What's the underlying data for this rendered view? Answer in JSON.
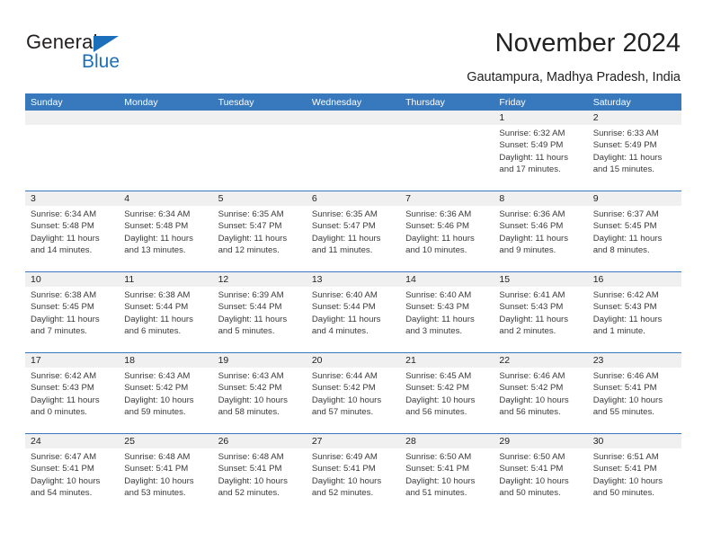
{
  "brand": {
    "name_part1": "General",
    "name_part2": "Blue",
    "accent_color": "#1c6fba"
  },
  "header": {
    "title": "November 2024",
    "location": "Gautampura, Madhya Pradesh, India"
  },
  "calendar": {
    "header_color": "#3878bd",
    "weekdays": [
      "Sunday",
      "Monday",
      "Tuesday",
      "Wednesday",
      "Thursday",
      "Friday",
      "Saturday"
    ],
    "weeks": [
      [
        {
          "day": "",
          "lines": []
        },
        {
          "day": "",
          "lines": []
        },
        {
          "day": "",
          "lines": []
        },
        {
          "day": "",
          "lines": []
        },
        {
          "day": "",
          "lines": []
        },
        {
          "day": "1",
          "lines": [
            "Sunrise: 6:32 AM",
            "Sunset: 5:49 PM",
            "Daylight: 11 hours",
            "and 17 minutes."
          ]
        },
        {
          "day": "2",
          "lines": [
            "Sunrise: 6:33 AM",
            "Sunset: 5:49 PM",
            "Daylight: 11 hours",
            "and 15 minutes."
          ]
        }
      ],
      [
        {
          "day": "3",
          "lines": [
            "Sunrise: 6:34 AM",
            "Sunset: 5:48 PM",
            "Daylight: 11 hours",
            "and 14 minutes."
          ]
        },
        {
          "day": "4",
          "lines": [
            "Sunrise: 6:34 AM",
            "Sunset: 5:48 PM",
            "Daylight: 11 hours",
            "and 13 minutes."
          ]
        },
        {
          "day": "5",
          "lines": [
            "Sunrise: 6:35 AM",
            "Sunset: 5:47 PM",
            "Daylight: 11 hours",
            "and 12 minutes."
          ]
        },
        {
          "day": "6",
          "lines": [
            "Sunrise: 6:35 AM",
            "Sunset: 5:47 PM",
            "Daylight: 11 hours",
            "and 11 minutes."
          ]
        },
        {
          "day": "7",
          "lines": [
            "Sunrise: 6:36 AM",
            "Sunset: 5:46 PM",
            "Daylight: 11 hours",
            "and 10 minutes."
          ]
        },
        {
          "day": "8",
          "lines": [
            "Sunrise: 6:36 AM",
            "Sunset: 5:46 PM",
            "Daylight: 11 hours",
            "and 9 minutes."
          ]
        },
        {
          "day": "9",
          "lines": [
            "Sunrise: 6:37 AM",
            "Sunset: 5:45 PM",
            "Daylight: 11 hours",
            "and 8 minutes."
          ]
        }
      ],
      [
        {
          "day": "10",
          "lines": [
            "Sunrise: 6:38 AM",
            "Sunset: 5:45 PM",
            "Daylight: 11 hours",
            "and 7 minutes."
          ]
        },
        {
          "day": "11",
          "lines": [
            "Sunrise: 6:38 AM",
            "Sunset: 5:44 PM",
            "Daylight: 11 hours",
            "and 6 minutes."
          ]
        },
        {
          "day": "12",
          "lines": [
            "Sunrise: 6:39 AM",
            "Sunset: 5:44 PM",
            "Daylight: 11 hours",
            "and 5 minutes."
          ]
        },
        {
          "day": "13",
          "lines": [
            "Sunrise: 6:40 AM",
            "Sunset: 5:44 PM",
            "Daylight: 11 hours",
            "and 4 minutes."
          ]
        },
        {
          "day": "14",
          "lines": [
            "Sunrise: 6:40 AM",
            "Sunset: 5:43 PM",
            "Daylight: 11 hours",
            "and 3 minutes."
          ]
        },
        {
          "day": "15",
          "lines": [
            "Sunrise: 6:41 AM",
            "Sunset: 5:43 PM",
            "Daylight: 11 hours",
            "and 2 minutes."
          ]
        },
        {
          "day": "16",
          "lines": [
            "Sunrise: 6:42 AM",
            "Sunset: 5:43 PM",
            "Daylight: 11 hours",
            "and 1 minute."
          ]
        }
      ],
      [
        {
          "day": "17",
          "lines": [
            "Sunrise: 6:42 AM",
            "Sunset: 5:43 PM",
            "Daylight: 11 hours",
            "and 0 minutes."
          ]
        },
        {
          "day": "18",
          "lines": [
            "Sunrise: 6:43 AM",
            "Sunset: 5:42 PM",
            "Daylight: 10 hours",
            "and 59 minutes."
          ]
        },
        {
          "day": "19",
          "lines": [
            "Sunrise: 6:43 AM",
            "Sunset: 5:42 PM",
            "Daylight: 10 hours",
            "and 58 minutes."
          ]
        },
        {
          "day": "20",
          "lines": [
            "Sunrise: 6:44 AM",
            "Sunset: 5:42 PM",
            "Daylight: 10 hours",
            "and 57 minutes."
          ]
        },
        {
          "day": "21",
          "lines": [
            "Sunrise: 6:45 AM",
            "Sunset: 5:42 PM",
            "Daylight: 10 hours",
            "and 56 minutes."
          ]
        },
        {
          "day": "22",
          "lines": [
            "Sunrise: 6:46 AM",
            "Sunset: 5:42 PM",
            "Daylight: 10 hours",
            "and 56 minutes."
          ]
        },
        {
          "day": "23",
          "lines": [
            "Sunrise: 6:46 AM",
            "Sunset: 5:41 PM",
            "Daylight: 10 hours",
            "and 55 minutes."
          ]
        }
      ],
      [
        {
          "day": "24",
          "lines": [
            "Sunrise: 6:47 AM",
            "Sunset: 5:41 PM",
            "Daylight: 10 hours",
            "and 54 minutes."
          ]
        },
        {
          "day": "25",
          "lines": [
            "Sunrise: 6:48 AM",
            "Sunset: 5:41 PM",
            "Daylight: 10 hours",
            "and 53 minutes."
          ]
        },
        {
          "day": "26",
          "lines": [
            "Sunrise: 6:48 AM",
            "Sunset: 5:41 PM",
            "Daylight: 10 hours",
            "and 52 minutes."
          ]
        },
        {
          "day": "27",
          "lines": [
            "Sunrise: 6:49 AM",
            "Sunset: 5:41 PM",
            "Daylight: 10 hours",
            "and 52 minutes."
          ]
        },
        {
          "day": "28",
          "lines": [
            "Sunrise: 6:50 AM",
            "Sunset: 5:41 PM",
            "Daylight: 10 hours",
            "and 51 minutes."
          ]
        },
        {
          "day": "29",
          "lines": [
            "Sunrise: 6:50 AM",
            "Sunset: 5:41 PM",
            "Daylight: 10 hours",
            "and 50 minutes."
          ]
        },
        {
          "day": "30",
          "lines": [
            "Sunrise: 6:51 AM",
            "Sunset: 5:41 PM",
            "Daylight: 10 hours",
            "and 50 minutes."
          ]
        }
      ]
    ]
  }
}
